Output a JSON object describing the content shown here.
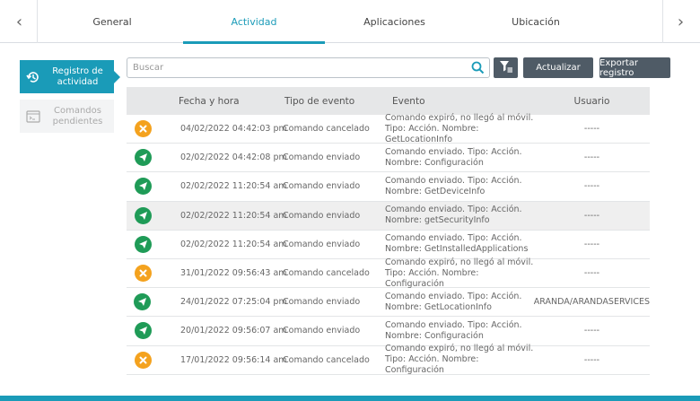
{
  "tabs": [
    {
      "label": "General",
      "active": false
    },
    {
      "label": "Actividad",
      "active": true
    },
    {
      "label": "Aplicaciones",
      "active": false
    },
    {
      "label": "Ubicación",
      "active": false
    }
  ],
  "sidebar": {
    "items": [
      {
        "label": "Registro de actividad",
        "icon": "history-icon",
        "active": true
      },
      {
        "label": "Comandos pendientes",
        "icon": "terminal-window-icon",
        "active": false
      }
    ]
  },
  "search": {
    "placeholder": "Buscar",
    "value": ""
  },
  "toolbar": {
    "refresh_label": "Actualizar",
    "export_label": "Exportar registro"
  },
  "table": {
    "columns": [
      "Fecha y hora",
      "Tipo de evento",
      "Evento",
      "Usuario"
    ],
    "rows": [
      {
        "status": "cancelled",
        "date": "04/02/2022 04:42:03 pm",
        "type": "Comando cancelado",
        "event": "Comando expiró, no llegó al móvil. Tipo: Acción. Nombre: GetLocationInfo",
        "user": "-----"
      },
      {
        "status": "sent",
        "date": "02/02/2022 04:42:08 pm",
        "type": "Comando enviado",
        "event": "Comando enviado. Tipo: Acción. Nombre: Configuración",
        "user": "-----"
      },
      {
        "status": "sent",
        "date": "02/02/2022 11:20:54 am",
        "type": "Comando enviado",
        "event": "Comando enviado. Tipo: Acción. Nombre: GetDeviceInfo",
        "user": "-----"
      },
      {
        "status": "sent",
        "date": "02/02/2022 11:20:54 am",
        "type": "Comando enviado",
        "event": "Comando enviado. Tipo: Acción. Nombre: getSecurityInfo",
        "user": "-----"
      },
      {
        "status": "sent",
        "date": "02/02/2022 11:20:54 am",
        "type": "Comando enviado",
        "event": "Comando enviado. Tipo: Acción. Nombre: GetInstalledApplications",
        "user": "-----"
      },
      {
        "status": "cancelled",
        "date": "31/01/2022 09:56:43 am",
        "type": "Comando cancelado",
        "event": "Comando expiró, no llegó al móvil. Tipo: Acción. Nombre: Configuración",
        "user": "-----"
      },
      {
        "status": "sent",
        "date": "24/01/2022 07:25:04 pm",
        "type": "Comando enviado",
        "event": "Comando enviado. Tipo: Acción. Nombre: GetLocationInfo",
        "user": "ARANDA/ARANDASERVICES"
      },
      {
        "status": "sent",
        "date": "20/01/2022 09:56:07 am",
        "type": "Comando enviado",
        "event": "Comando enviado. Tipo: Acción. Nombre: Configuración",
        "user": "-----"
      },
      {
        "status": "cancelled",
        "date": "17/01/2022 09:56:14 am",
        "type": "Comando cancelado",
        "event": "Comando expiró, no llegó al móvil. Tipo: Acción. Nombre: Configuración",
        "user": "-----"
      }
    ]
  },
  "colors": {
    "accent": "#1a9bb8",
    "button": "#4f5b66",
    "cancelled": "#f4a21e",
    "sent": "#1f9b57"
  }
}
